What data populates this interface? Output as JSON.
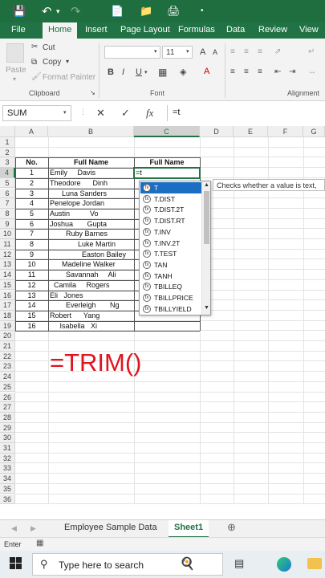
{
  "ribbon_tabs": [
    "File",
    "Home",
    "Insert",
    "Page Layout",
    "Formulas",
    "Data",
    "Review",
    "View"
  ],
  "active_tab": "Home",
  "clipboard": {
    "cut": "Cut",
    "copy": "Copy",
    "format_painter": "Format Painter",
    "paste": "Paste",
    "group": "Clipboard"
  },
  "font": {
    "size": "11",
    "bold": "B",
    "italic": "I",
    "underline": "U",
    "grow": "A",
    "shrink": "A",
    "group": "Font"
  },
  "alignment": {
    "group": "Alignment"
  },
  "formula_bar": {
    "name_box": "SUM",
    "cancel": "✕",
    "enter": "✓",
    "fx": "fx",
    "content": "=t"
  },
  "columns": [
    "A",
    "B",
    "C",
    "D",
    "E",
    "F",
    "G"
  ],
  "rows": [
    "1",
    "2",
    "3",
    "4",
    "5",
    "6",
    "7",
    "8",
    "9",
    "10",
    "11",
    "12",
    "13",
    "14",
    "15",
    "16",
    "17",
    "18",
    "19",
    "20",
    "21",
    "22",
    "23",
    "24",
    "25",
    "26",
    "27",
    "28",
    "29",
    "30",
    "31",
    "32",
    "33",
    "34",
    "35",
    "36"
  ],
  "table": {
    "header_no": "No.",
    "header_full_name_b": "Full Name",
    "header_full_name_c": "Full Name",
    "rows": [
      {
        "no": "1",
        "name": "Emily     Davis"
      },
      {
        "no": "2",
        "name": "Theodore      Dinh"
      },
      {
        "no": "3",
        "name": "      Luna Sanders"
      },
      {
        "no": "4",
        "name": "Penelope Jordan"
      },
      {
        "no": "5",
        "name": "Austin          Vo"
      },
      {
        "no": "6",
        "name": "Joshua       Gupta"
      },
      {
        "no": "7",
        "name": "        Ruby Barnes"
      },
      {
        "no": "8",
        "name": "              Luke Martin"
      },
      {
        "no": "9",
        "name": "                Easton Bailey"
      },
      {
        "no": "10",
        "name": "      Madeline Walker"
      },
      {
        "no": "11",
        "name": "        Savannah     Ali"
      },
      {
        "no": "12",
        "name": "  Camila     Rogers"
      },
      {
        "no": "13",
        "name": "Eli   Jones"
      },
      {
        "no": "14",
        "name": "        Everleigh       Ng"
      },
      {
        "no": "15",
        "name": "Robert      Yang"
      },
      {
        "no": "16",
        "name": "     Isabella   Xi"
      }
    ],
    "active_input": "=t"
  },
  "autocomplete": {
    "items": [
      "T",
      "T.DIST",
      "T.DIST.2T",
      "T.DIST.RT",
      "T.INV",
      "T.INV.2T",
      "T.TEST",
      "TAN",
      "TANH",
      "TBILLEQ",
      "TBILLPRICE",
      "TBILLYIELD"
    ],
    "selected": "T",
    "tooltip": "Checks whether a value is text,"
  },
  "overlay_text": "=TRIM()",
  "sheets": [
    "Employee Sample Data",
    "Sheet1"
  ],
  "active_sheet": "Sheet1",
  "status": "Enter",
  "taskbar": {
    "search_placeholder": "Type here to search"
  },
  "colors": {
    "excel_green": "#217346",
    "title_green": "#1e6e3f",
    "overlay_red": "#e0141e",
    "selection_blue": "#1b6ec2"
  }
}
